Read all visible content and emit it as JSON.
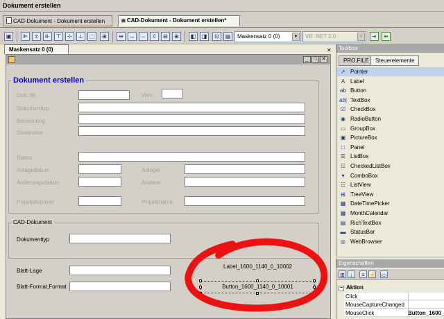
{
  "window_title": "Dokument erstellen",
  "doc_tabs": [
    "CAD-Dokument - Dokument erstellen",
    "CAD-Dokument - Dokument erstellen*"
  ],
  "toolbar": {
    "mask_select": "Maskensatz 0 (0)",
    "language_select": "VB .NET 2.0"
  },
  "mask_tab": "Maskensatz 0 (0)",
  "form": {
    "group1_title": "Dokument erstellen",
    "labels": {
      "doknr": "Dok.-Nr.",
      "vers": "Vers.",
      "dokumenttyp": "Dokumenttyp",
      "benennung": "Benennung",
      "dateiname": "Dateiname",
      "status": "Status",
      "anlagedatum": "Anlagedatum",
      "anleger": "Anleger",
      "aenderungsdatum": "Änderungsdatum",
      "aenderer": "Änderer",
      "projektnummer": "Projektnummer",
      "projektname": "Projektname"
    },
    "group2_title": "CAD-Dokument",
    "cad_dokumenttyp": "Dokumenttyp",
    "blatt_lage": "Blatt-Lage",
    "blatt_format": "Blatt-Format,Format",
    "label_control": "Label_1600_1140_0_10002",
    "button_control": "Button_1600_1140_0_10001"
  },
  "toolbox": {
    "title": "Toolbox",
    "tabs": [
      "PRO.FILE",
      "Steuerelemente"
    ],
    "items": [
      {
        "label": "Pointer",
        "icon": "pointer-icon",
        "glyph": "➚"
      },
      {
        "label": "Label",
        "icon": "label-icon",
        "glyph": "A"
      },
      {
        "label": "Button",
        "icon": "button-icon",
        "glyph": "ab"
      },
      {
        "label": "TextBox",
        "icon": "textbox-icon",
        "glyph": "ab|"
      },
      {
        "label": "CheckBox",
        "icon": "checkbox-icon",
        "glyph": "☑"
      },
      {
        "label": "RadioButton",
        "icon": "radiobutton-icon",
        "glyph": "◉"
      },
      {
        "label": "GroupBox",
        "icon": "groupbox-icon",
        "glyph": "▭"
      },
      {
        "label": "PictureBox",
        "icon": "picturebox-icon",
        "glyph": "▣"
      },
      {
        "label": "Panel",
        "icon": "panel-icon",
        "glyph": "□"
      },
      {
        "label": "ListBox",
        "icon": "listbox-icon",
        "glyph": "☰"
      },
      {
        "label": "CheckedListBox",
        "icon": "checkedlistbox-icon",
        "glyph": "☷"
      },
      {
        "label": "ComboBox",
        "icon": "combobox-icon",
        "glyph": "▾"
      },
      {
        "label": "ListView",
        "icon": "listview-icon",
        "glyph": "☷"
      },
      {
        "label": "TreeView",
        "icon": "treeview-icon",
        "glyph": "⊞"
      },
      {
        "label": "DateTimePicker",
        "icon": "datetimepicker-icon",
        "glyph": "▦"
      },
      {
        "label": "MonthCalendar",
        "icon": "monthcalendar-icon",
        "glyph": "▦"
      },
      {
        "label": "RichTextBox",
        "icon": "richtextbox-icon",
        "glyph": "▤"
      },
      {
        "label": "StatusBar",
        "icon": "statusbar-icon",
        "glyph": "▬"
      },
      {
        "label": "WebBrowser",
        "icon": "webbrowser-icon",
        "glyph": "◎"
      }
    ]
  },
  "properties": {
    "title": "Eigenschaften",
    "category": "Aktion",
    "rows": [
      {
        "name": "Click",
        "value": ""
      },
      {
        "name": "MouseCaptureChanged",
        "value": ""
      },
      {
        "name": "MouseClick",
        "value": "Button_1600_"
      }
    ]
  },
  "colors": {
    "accent_title": "#0000c0",
    "annotation_red": "#ee1111",
    "selection": "#c1d2ee"
  }
}
